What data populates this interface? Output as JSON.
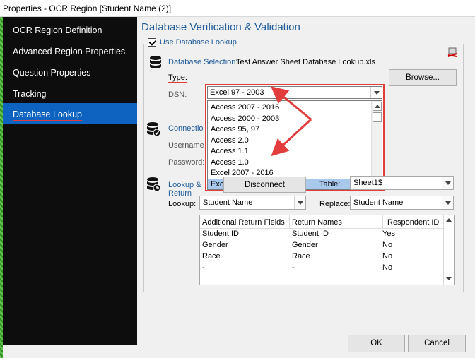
{
  "window": {
    "title": "Properties - OCR Region [Student Name (2)]"
  },
  "sidebar": {
    "items": [
      {
        "label": "OCR Region Definition"
      },
      {
        "label": "Advanced Region Properties"
      },
      {
        "label": "Question Properties"
      },
      {
        "label": "Tracking"
      },
      {
        "label": "Database Lookup",
        "active": true
      }
    ]
  },
  "main": {
    "heading": "Database Verification & Validation",
    "use_lookup": {
      "label": "Use Database Lookup",
      "checked": true
    },
    "db_selection": {
      "label": "Database Selection:",
      "value": "Test Answer Sheet Database Lookup.xls"
    },
    "type": {
      "label": "Type:",
      "selected": "Excel 97 - 2003"
    },
    "dsn": {
      "label": "DSN:"
    },
    "browse_label": "Browse...",
    "connection": {
      "label": "Connectio",
      "username_label": "Username",
      "password_label": "Password:"
    },
    "type_options": [
      "Access 2007 - 2016",
      "Access 2000 - 2003",
      "Access 95, 97",
      "Access 2.0",
      "Access 1.1",
      "Access 1.0",
      "Excel 2007 - 2016",
      "Excel 97 - 2003"
    ],
    "lookup_return": {
      "label_line1": "Lookup &",
      "label_line2": "Return"
    },
    "disconnect_label": "Disconnect",
    "table": {
      "label": "Table:",
      "value": "Sheet1$"
    },
    "lookup": {
      "label": "Lookup:",
      "value": "Student Name"
    },
    "replace": {
      "label": "Replace:",
      "value": "Student Name"
    },
    "grid": {
      "headers": [
        "Additional Return Fields",
        "Return Names",
        "Respondent ID"
      ],
      "rows": [
        [
          "Student ID",
          "Student ID",
          "Yes"
        ],
        [
          "Gender",
          "Gender",
          "No"
        ],
        [
          "Race",
          "Race",
          "No"
        ],
        [
          "-",
          "-",
          "No"
        ]
      ]
    },
    "ok_label": "OK",
    "cancel_label": "Cancel"
  },
  "colors": {
    "accent_blue": "#1f5c99",
    "sidebar_bg": "#0d0d0d",
    "active_item": "#0e63c0",
    "annotation_red": "#e23c3c"
  }
}
